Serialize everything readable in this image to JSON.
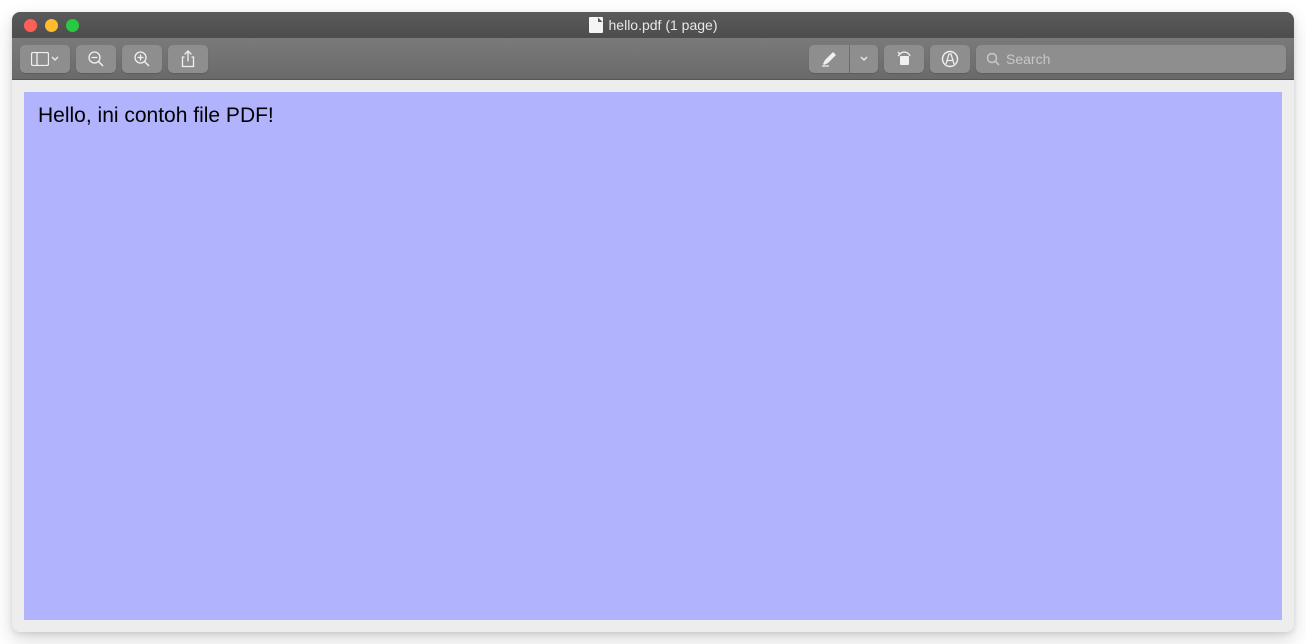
{
  "window": {
    "title": "hello.pdf (1 page)"
  },
  "search": {
    "placeholder": "Search",
    "value": ""
  },
  "document": {
    "content": "Hello, ini contoh file PDF!"
  }
}
